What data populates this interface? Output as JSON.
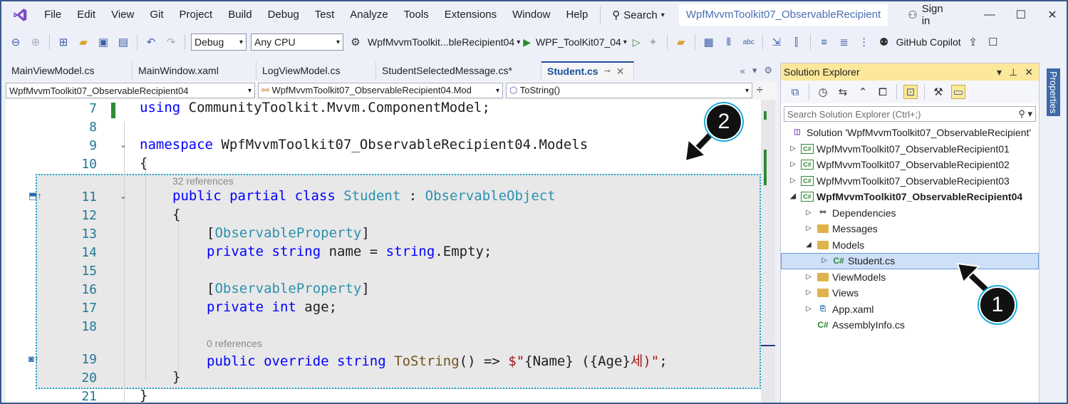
{
  "menubar": {
    "items": [
      "File",
      "Edit",
      "View",
      "Git",
      "Project",
      "Build",
      "Debug",
      "Test",
      "Analyze",
      "Tools",
      "Extensions",
      "Window",
      "Help"
    ],
    "search_label": "Search",
    "window_title": "WpfMvvmToolkit07_ObservableRecipient",
    "signin_label": "Sign in"
  },
  "toolbar": {
    "config": "Debug",
    "platform": "Any CPU",
    "startup_project": "WpfMvvmToolkit...bleRecipient04",
    "run_target": "WPF_ToolKit07_04",
    "copilot_label": "GitHub Copilot"
  },
  "doctabs": {
    "tabs": [
      "MainViewModel.cs",
      "MainWindow.xaml",
      "LogViewModel.cs",
      "StudentSelectedMessage.cs*"
    ],
    "active": "Student.cs"
  },
  "navbar": {
    "project": "WpfMvvmToolkit07_ObservableRecipient04",
    "type": "WpfMvvmToolkit07_ObservableRecipient04.Mod",
    "member": "ToString()"
  },
  "editor": {
    "line_numbers": [
      "7",
      "8",
      "9",
      "10",
      "11",
      "12",
      "13",
      "14",
      "15",
      "16",
      "17",
      "18",
      "19",
      "20",
      "21"
    ],
    "codelens_class": "32 references",
    "codelens_tostring": "0 references",
    "line7": {
      "kw": "using",
      "rest": " CommunityToolkit.Mvvm.ComponentModel;"
    },
    "line9": {
      "kw": "namespace",
      "rest": " WpfMvvmToolkit07_ObservableRecipient04.Models"
    },
    "line10": "{",
    "line11": {
      "kw": "public partial class",
      "name": "Student",
      "sep": " : ",
      "base": "ObservableObject"
    },
    "line12": "{",
    "line13": {
      "open": "[",
      "attr": "ObservableProperty",
      "close": "]"
    },
    "line14": {
      "kw": "private string",
      "mid": " name = ",
      "kw2": "string",
      "rest": ".Empty;"
    },
    "line16": {
      "open": "[",
      "attr": "ObservableProperty",
      "close": "]"
    },
    "line17": {
      "kw": "private int",
      "rest": " age;"
    },
    "line19": {
      "kw": "public override string",
      "meth": "ToString",
      "rest": "() => ",
      "str1": "$\"",
      "interp": "{Name} ({Age}",
      "str2": "세)\"",
      "end": ";"
    },
    "line20": "}",
    "line21": "}"
  },
  "solution_explorer": {
    "title": "Solution Explorer",
    "search_placeholder": "Search Solution Explorer (Ctrl+;)",
    "solution": "Solution 'WpfMvvmToolkit07_ObservableRecipient'",
    "projects": [
      "WpfMvvmToolkit07_ObservableRecipient01",
      "WpfMvvmToolkit07_ObservableRecipient02",
      "WpfMvvmToolkit07_ObservableRecipient03",
      "WpfMvvmToolkit07_ObservableRecipient04"
    ],
    "items": [
      "Dependencies",
      "Messages",
      "Models",
      "Student.cs",
      "ViewModels",
      "Views",
      "App.xaml",
      "AssemblyInfo.cs"
    ]
  },
  "properties_label": "Properties",
  "callouts": [
    "1",
    "2"
  ]
}
